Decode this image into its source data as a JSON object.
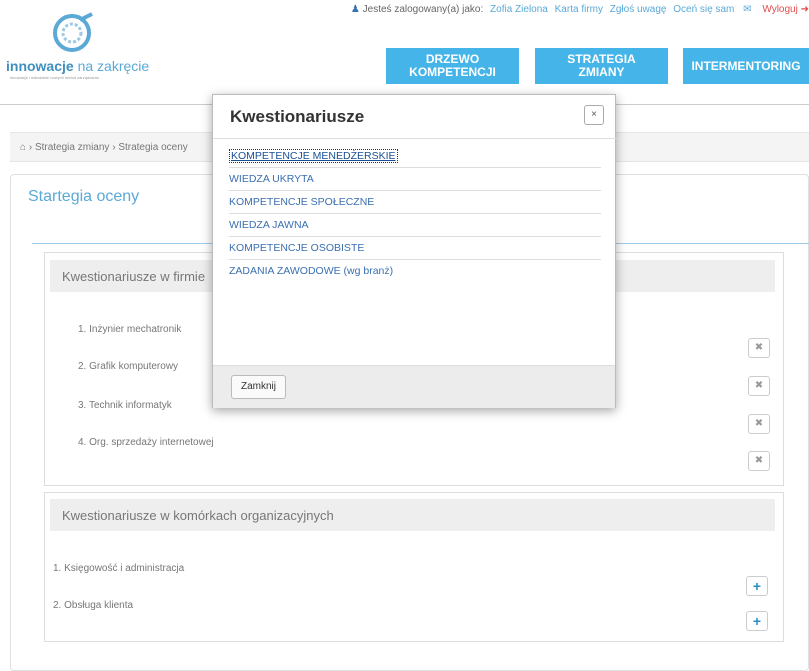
{
  "header": {
    "logo_bold": "innowacje",
    "logo_rest": " na zakręcie",
    "logo_sub": "innowacje i wdrażanie nowych metod zarządzania",
    "user_prefix": "Jesteś zalogowany(a) jako:",
    "user_name": "Zofia Zielona",
    "links": [
      "Karta firmy",
      "Zgłoś uwagę",
      "Oceń się sam"
    ],
    "logout": "Wyloguj",
    "nav": [
      "DRZEWO\nKOMPETENCJI",
      "STRATEGIA\nZMIANY",
      "INTERMENTORING"
    ]
  },
  "breadcrumb": [
    "Strategia zmiany",
    "Strategia oceny"
  ],
  "page_title": "Startegia oceny",
  "section1": {
    "title": "Kwestionariusze w firmie",
    "rows": [
      "1. Inżynier mechatronik",
      "2. Grafik komputerowy",
      "3. Technik informatyk",
      "4. Org. sprzedaży internetowej"
    ]
  },
  "section2": {
    "title": "Kwestionariusze w komórkach organizacyjnych",
    "rows": [
      "1. Księgowość i administracja",
      "2. Obsługa klienta"
    ]
  },
  "modal": {
    "title": "Kwestionariusze",
    "close_label": "×",
    "items": [
      "KOMPETENCJE MENEDŻERSKIE",
      "WIEDZA UKRYTA",
      "KOMPETENCJE SPOŁECZNE",
      "WIEDZA JAWNA",
      "KOMPETENCJE OSOBISTE",
      "ZADANIA ZAWODOWE (wg branż)"
    ],
    "button": "Zamknij"
  },
  "icons": {
    "home": "⌂",
    "trash": "🗑",
    "plus": "+",
    "user": "user-icon",
    "mail": "mail-icon"
  },
  "colors": {
    "accent": "#45b4e8",
    "link": "#5aa9d6",
    "logout": "#e04c4c"
  }
}
